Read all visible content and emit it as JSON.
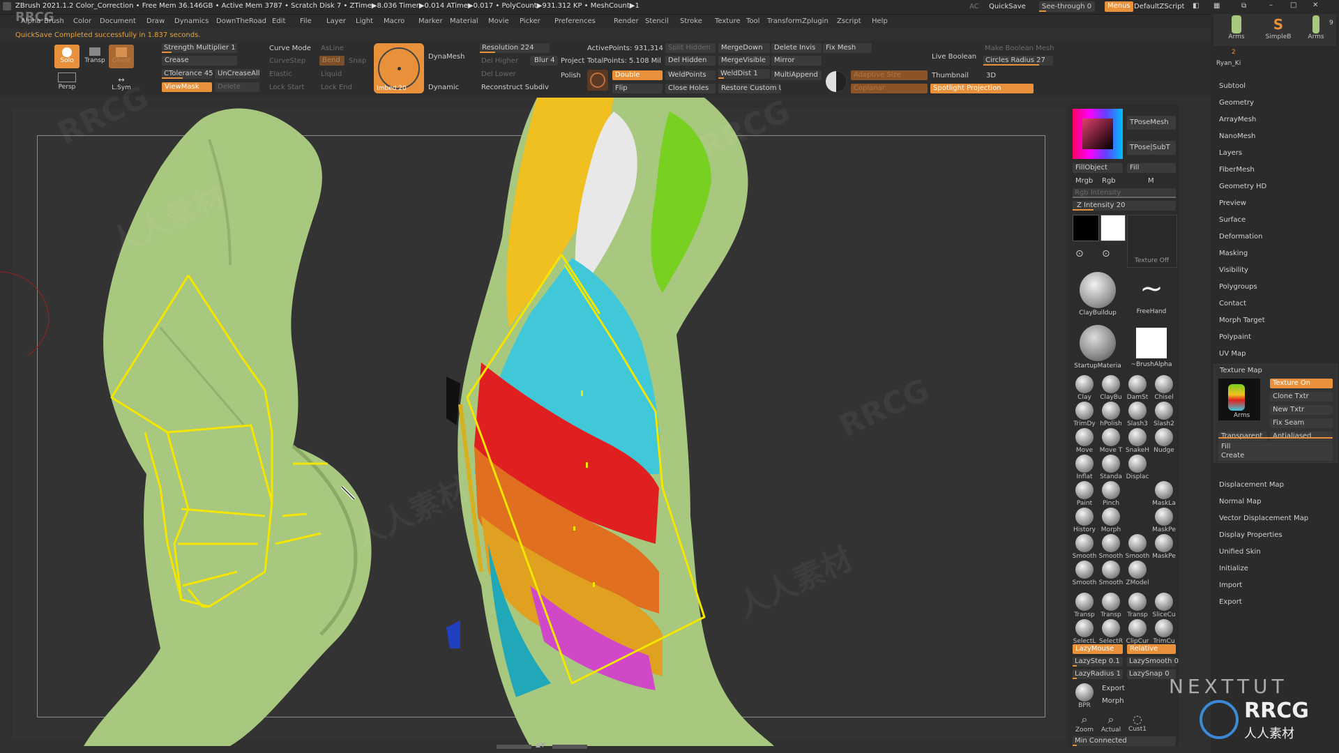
{
  "title_bar": {
    "status": "ZBrush 2021.1.2   Color_Correction   • Free Mem 36.146GB • Active Mem 3787 • Scratch Disk 7 • ZTime▶8.036 Timer▶0.014 ATime▶0.017 • PolyCount▶931.312 KP • MeshCount▶1",
    "ac_label": "AC",
    "quicksave": "QuickSave",
    "see_through": "See-through  0",
    "menus": "Menus",
    "script": "DefaultZScript"
  },
  "menu_bar": [
    "Alpha",
    "Brush",
    "Color",
    "Document",
    "Draw",
    "Dynamics",
    "DownTheRoad",
    "Edit",
    "File",
    "Layer",
    "Light",
    "Macro",
    "Marker",
    "Material",
    "Movie",
    "Picker",
    "Preferences",
    "Render",
    "Stencil",
    "Stroke",
    "Texture",
    "Tool",
    "Transform",
    "Zplugin",
    "Zscript",
    "Help"
  ],
  "notice": "QuickSave Completed successfully in 1.837 seconds.",
  "left_tools": {
    "solo": "Solo",
    "transp": "Transp",
    "ghost": "Ghost",
    "persp": "Persp",
    "lsym": "L.Sym"
  },
  "shelf": {
    "strength_multiplier": "Strength Multiplier 1",
    "crease": "Crease",
    "ctolerance": "CTolerance 45",
    "uncrease_all": "UnCreaseAll",
    "viewmask": "ViewMask",
    "delete": "Delete",
    "curve_mode": "Curve Mode",
    "curve_step": "CurveStep",
    "elastic": "Elastic",
    "lock_start": "Lock Start",
    "asline": "AsLine",
    "bend": "Bend",
    "snap": "Snap",
    "liquid": "Liquid",
    "lock_end": "Lock End",
    "imbed": "Imbed 20",
    "dynamesh": "DynaMesh",
    "dynamic": "Dynamic",
    "resolution": "Resolution 224",
    "del_higher": "Del Higher",
    "del_lower": "Del Lower",
    "blur": "Blur 4",
    "reconstruct": "Reconstruct Subdiv",
    "project": "Project",
    "polish": "Polish",
    "active_points": "ActivePoints: 931,314",
    "total_points": "TotalPoints: 5.108 Mil",
    "double": "Double",
    "flip": "Flip",
    "split_hidden": "Split Hidden",
    "del_hidden": "Del Hidden",
    "weld_points": "WeldPoints",
    "close_holes": "Close Holes",
    "merge_down": "MergeDown",
    "merge_visible": "MergeVisible",
    "weld_dist": "WeldDist 1",
    "restore_ui": "Restore Custom UI",
    "delete_invis": "Delete Invis",
    "mirror": "Mirror",
    "multi_append": "MultiAppend",
    "fix_mesh": "Fix Mesh",
    "adaptive_size": "Adaptive Size",
    "coplanar": "Coplanar",
    "live_boolean": "Live Boolean",
    "thumbnail": "Thumbnail",
    "spotlight": "Spotlight Projection",
    "make_boolean": "Make Boolean Mesh",
    "circles_radius": "Circles Radius 27",
    "three_d": "3D"
  },
  "color_panel": {
    "tpose_mesh": "TPoseMesh",
    "tpose_subt": "TPose|SubT",
    "fill_object": "FillObject",
    "fill": "Fill",
    "mrgb": "Mrgb",
    "rgb": "Rgb",
    "m": "M",
    "rgb_intensity": "Rgb Intensity",
    "z_intensity": "Z Intensity 20",
    "texture_off": "Texture Off",
    "claybuildup": "ClayBuildup",
    "freehand": "FreeHand",
    "startup_material": "StartupMateria",
    "brush_alpha": "~BrushAlpha"
  },
  "brushes": [
    [
      "Clay",
      "ClayBu",
      "DamSt",
      "Chisel"
    ],
    [
      "TrimDy",
      "hPolish",
      "Slash3",
      "Slash2"
    ],
    [
      "Move",
      "Move T",
      "SnakeH",
      "Nudge"
    ],
    [
      "Inflat",
      "Standa",
      "Displac",
      ""
    ],
    [
      "Paint",
      "Pinch",
      "",
      "MaskLa"
    ],
    [
      "History",
      "Morph",
      "",
      "MaskPe"
    ],
    [
      "Smooth",
      "Smooth",
      "Smooth",
      "MaskPe"
    ],
    [
      "Smooth",
      "Smooth",
      "ZModel",
      ""
    ],
    [
      "Transp",
      "Transp",
      "Transp",
      "SliceCu"
    ],
    [
      "SelectL",
      "SelectR",
      "ClipCur",
      "TrimCu"
    ]
  ],
  "lazy": {
    "lazymouse": "LazyMouse",
    "relative": "Relative",
    "lazystep": "LazyStep 0.1",
    "lazysmooth": "LazySmooth 0",
    "lazyradius": "LazyRadius 1",
    "lazysnap": "LazySnap 0",
    "bpr": "BPR",
    "export": "Export",
    "morph": "Morph",
    "zoom": "Zoom",
    "actual": "Actual",
    "cust1": "Cust1",
    "min_connected": "Min Connected"
  },
  "subtool_panel": {
    "thumb_labels": [
      "Arms",
      "SimpleB",
      "Arms"
    ],
    "count": "9",
    "tool_num": "2",
    "author": "Ryan_Ki",
    "items": [
      "Subtool",
      "Geometry",
      "ArrayMesh",
      "NanoMesh",
      "Layers",
      "FiberMesh",
      "Geometry HD",
      "Preview",
      "Surface",
      "Deformation",
      "Masking",
      "Visibility",
      "Polygroups",
      "Contact",
      "Morph Target",
      "Polypaint",
      "UV Map"
    ],
    "texture_map": "Texture Map",
    "texture_on": "Texture On",
    "clone_txtr": "Clone Txtr",
    "new_txtr": "New Txtr",
    "fix_seam": "Fix Seam",
    "arms_thumb": "Arms",
    "transparent": "Transparent",
    "antialiased": "Antialiased",
    "fill": "Fill",
    "create": "Create",
    "items2": [
      "Displacement Map",
      "Normal Map",
      "Vector Displacement Map",
      "Display Properties",
      "Unified Skin",
      "Initialize",
      "Import",
      "Export"
    ]
  },
  "watermarks": {
    "logo": "RRCG",
    "cn": "人人素材",
    "nextut": "NEXTTUT"
  },
  "colors": {
    "accent": "#e8913a",
    "mesh_green": "#a8c77f",
    "overlay_yellow": "#f5e600"
  }
}
